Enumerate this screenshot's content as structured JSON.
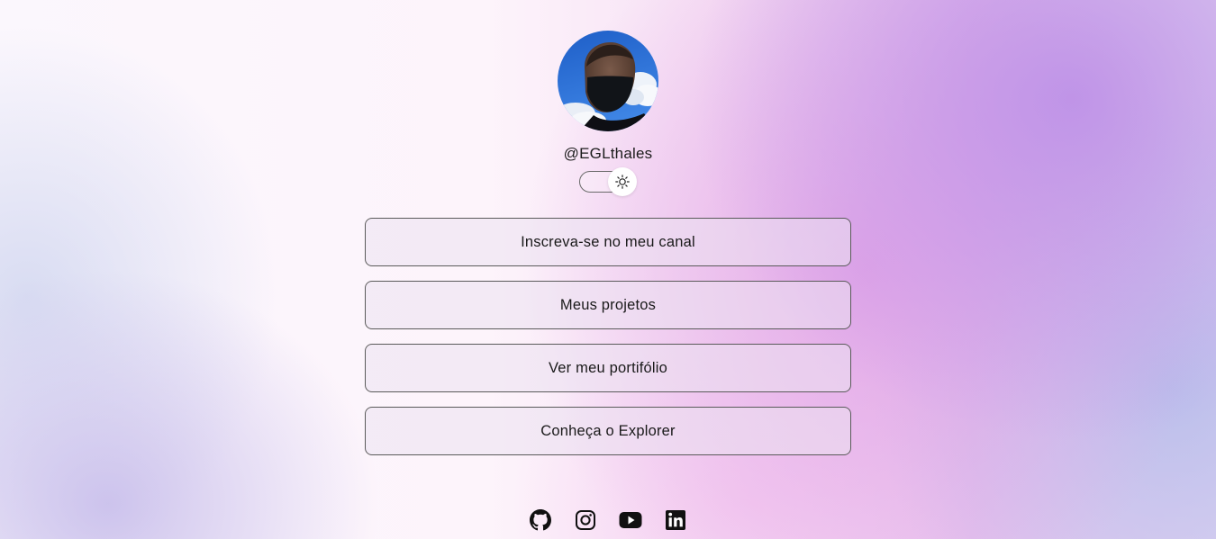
{
  "profile": {
    "username": "@EGLthales",
    "avatar_alt": "avatar"
  },
  "theme_toggle": {
    "icon": "sun-icon"
  },
  "links": [
    {
      "label": "Inscreva-se no meu canal"
    },
    {
      "label": "Meus projetos"
    },
    {
      "label": "Ver meu portifólio"
    },
    {
      "label": "Conheça o Explorer"
    }
  ],
  "socials": [
    {
      "icon": "github-icon"
    },
    {
      "icon": "instagram-icon"
    },
    {
      "icon": "youtube-icon"
    },
    {
      "icon": "linkedin-icon"
    }
  ],
  "colors": {
    "text": "#1a1a1a",
    "border": "#5a5a5a",
    "sky_blue": "#2f72d8",
    "accent_purple": "#c39ae8"
  }
}
